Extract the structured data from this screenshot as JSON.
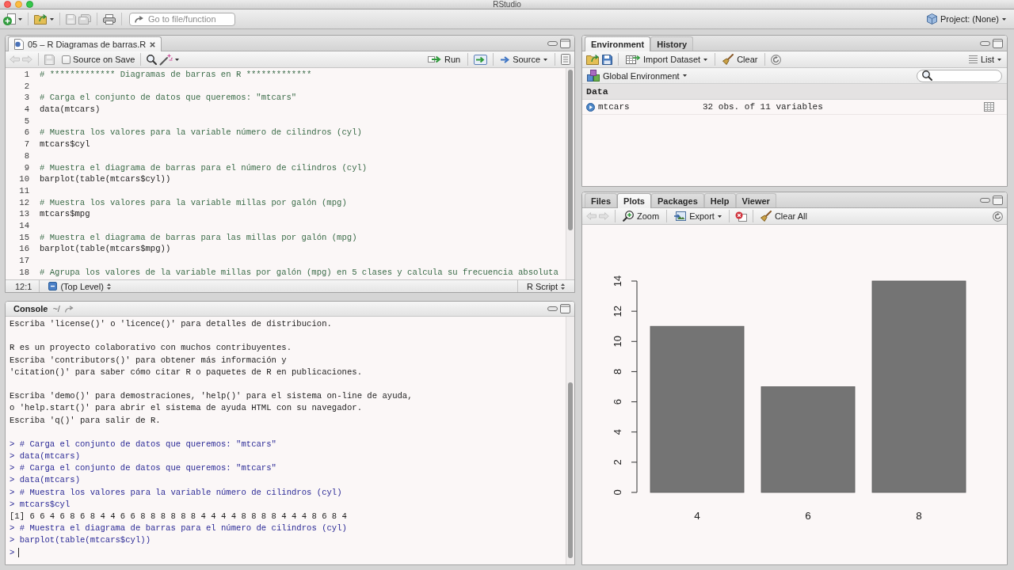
{
  "window": {
    "title": "RStudio"
  },
  "toolbar": {
    "save": {
      "disabled": true
    },
    "save_all": {
      "disabled": true
    },
    "goto": {
      "placeholder": "Go to file/function"
    },
    "project": "Project: (None)"
  },
  "editor": {
    "tabs": [
      {
        "label": "05 – R Diagramas de barras.R",
        "selected": true
      }
    ],
    "nav": {
      "back": {
        "disabled": true
      },
      "forward": {
        "disabled": true
      }
    },
    "save": {
      "disabled": true
    },
    "source_on_save": {
      "label": "Source on Save",
      "checked": false
    },
    "run": "Run",
    "source": "Source",
    "lines": [
      {
        "number": "1",
        "kind": "comment",
        "text": "# ************* Diagramas de barras en R *************"
      },
      {
        "number": "2",
        "kind": "blank"
      },
      {
        "number": "3",
        "kind": "comment",
        "text": "# Carga el conjunto de datos que queremos: \"mtcars\""
      },
      {
        "number": "4",
        "kind": "code",
        "text": "data(mtcars)"
      },
      {
        "number": "5",
        "kind": "blank"
      },
      {
        "number": "6",
        "kind": "comment",
        "text": "# Muestra los valores para la variable número de cilindros (cyl)"
      },
      {
        "number": "7",
        "kind": "code",
        "text": "mtcars$cyl"
      },
      {
        "number": "8",
        "kind": "blank"
      },
      {
        "number": "9",
        "kind": "comment",
        "text": "# Muestra el diagrama de barras para el número de cilindros (cyl)"
      },
      {
        "number": "10",
        "kind": "code",
        "text": "barplot(table(mtcars$cyl))"
      },
      {
        "number": "11",
        "kind": "blank"
      },
      {
        "number": "12",
        "kind": "comment",
        "text": "# Muestra los valores para la variable millas por galón (mpg)"
      },
      {
        "number": "13",
        "kind": "code",
        "text": "mtcars$mpg"
      },
      {
        "number": "14",
        "kind": "blank"
      },
      {
        "number": "15",
        "kind": "comment",
        "text": "# Muestra el diagrama de barras para las millas por galón (mpg)"
      },
      {
        "number": "16",
        "kind": "code",
        "text": "barplot(table(mtcars$mpg))"
      },
      {
        "number": "17",
        "kind": "blank"
      },
      {
        "number": "18",
        "kind": "comment",
        "text": "# Agrupa los valores de la variable millas por galón (mpg) en 5 clases y calcula su frecuencia absoluta"
      }
    ],
    "status": {
      "position": "12:1",
      "scope": "(Top Level)",
      "file_type": "R Script"
    }
  },
  "console": {
    "title": "Console",
    "path": "~/",
    "blocks": [
      {
        "lines": [
          {
            "kind": "output",
            "text": "Escriba 'license()' o 'licence()' para detalles de distribucion."
          }
        ]
      },
      {
        "lines": [
          {
            "kind": "output",
            "text": "R es un proyecto colaborativo con muchos contribuyentes."
          },
          {
            "kind": "output",
            "text": "Escriba 'contributors()' para obtener más información y"
          },
          {
            "kind": "output",
            "text": "'citation()' para saber cómo citar R o paquetes de R en publicaciones."
          }
        ]
      },
      {
        "lines": [
          {
            "kind": "output",
            "text": "Escriba 'demo()' para demostraciones, 'help()' para el sistema on-line de ayuda,"
          },
          {
            "kind": "output",
            "text": "o 'help.start()' para abrir el sistema de ayuda HTML con su navegador."
          },
          {
            "kind": "output",
            "text": "Escriba 'q()' para salir de R."
          }
        ]
      },
      {
        "lines": [
          {
            "kind": "input",
            "text": "> # Carga el conjunto de datos que queremos: \"mtcars\""
          },
          {
            "kind": "input",
            "text": "> data(mtcars)"
          },
          {
            "kind": "input",
            "text": "> # Carga el conjunto de datos que queremos: \"mtcars\""
          },
          {
            "kind": "input",
            "text": "> data(mtcars)"
          },
          {
            "kind": "input",
            "text": "> # Muestra los valores para la variable número de cilindros (cyl)"
          },
          {
            "kind": "input",
            "text": "> mtcars$cyl"
          },
          {
            "kind": "output",
            "text": "[1] 6 6 4 6 8 6 8 4 4 6 6 8 8 8 8 8 8 4 4 4 4 8 8 8 8 4 4 4 8 6 8 4"
          },
          {
            "kind": "input",
            "text": "> # Muestra el diagrama de barras para el número de cilindros (cyl)"
          },
          {
            "kind": "input",
            "text": "> barplot(table(mtcars$cyl))"
          },
          {
            "kind": "prompt",
            "text": ">"
          }
        ]
      }
    ]
  },
  "environment": {
    "tabs": [
      {
        "label": "Environment",
        "selected": true
      },
      {
        "label": "History",
        "selected": false
      }
    ],
    "import": "Import Dataset",
    "clear": "Clear",
    "view": "List",
    "scope": "Global Environment",
    "sections": [
      {
        "title": "Data",
        "rows": [
          {
            "name": "mtcars",
            "value": "32 obs. of 11 variables"
          }
        ]
      }
    ]
  },
  "plots": {
    "tabs": [
      {
        "label": "Files",
        "selected": false
      },
      {
        "label": "Plots",
        "selected": true
      },
      {
        "label": "Packages",
        "selected": false
      },
      {
        "label": "Help",
        "selected": false
      },
      {
        "label": "Viewer",
        "selected": false
      }
    ],
    "nav": {
      "back": {
        "disabled": true
      },
      "forward": {
        "disabled": true
      }
    },
    "zoom": "Zoom",
    "export": "Export",
    "clear_all": "Clear All",
    "chart_data": {
      "type": "bar",
      "categories": [
        "4",
        "6",
        "8"
      ],
      "values": [
        11,
        7,
        14
      ],
      "color": "#747474",
      "yticks": [
        0,
        2,
        4,
        6,
        8,
        10,
        12,
        14
      ],
      "ylim": [
        0,
        14
      ]
    }
  }
}
